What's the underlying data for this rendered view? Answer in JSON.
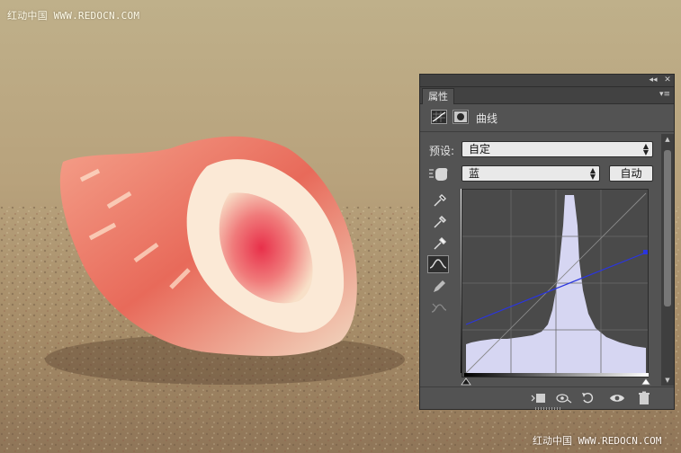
{
  "watermark": {
    "top": "红动中国 WWW.REDOCN.COM",
    "bottom": "红动中国 WWW.REDOCN.COM"
  },
  "panel": {
    "tab_label": "属性",
    "adjustment_title": "曲线",
    "preset_label": "预设:",
    "preset_value": "自定",
    "channel_value": "蓝",
    "auto_button": "自动",
    "icons": {
      "collapse": "double-chevron-left-icon",
      "close": "close-icon",
      "menu": "panel-menu-icon",
      "curves_adjustment": "curves-adjustment-icon",
      "layer_mask": "layer-mask-icon",
      "on_image_adjust": "hand-adjust-icon",
      "sample_black": "eyedropper-black-icon",
      "sample_gray": "eyedropper-gray-icon",
      "sample_white": "eyedropper-white-icon",
      "edit_points": "curve-tool-icon",
      "draw_pencil": "pencil-icon",
      "smooth": "smooth-curve-icon",
      "clip_to_layer": "clip-to-layer-icon",
      "view_previous": "view-previous-icon",
      "reset": "reset-icon",
      "toggle_visibility": "eye-icon",
      "delete": "trash-icon"
    },
    "colors": {
      "curve_line": "#2a35e0",
      "histogram_fill": "#d6d6f2",
      "panel_bg": "#535353"
    }
  }
}
